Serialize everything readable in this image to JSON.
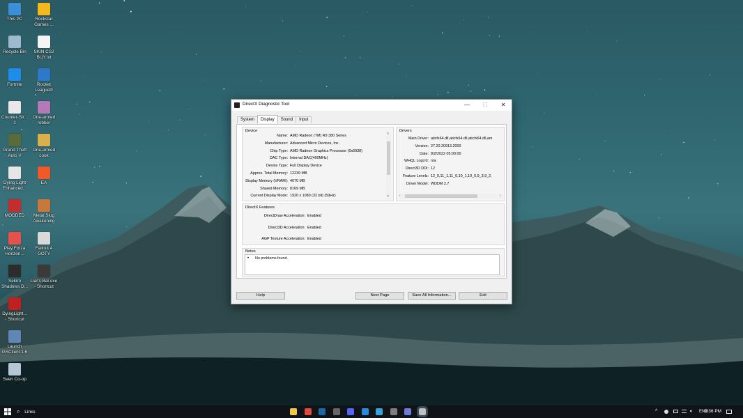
{
  "desktop_icons": [
    {
      "label": "This PC",
      "color": "#3b8fd6"
    },
    {
      "label": "Recycle Bin",
      "color": "#9fb9cf"
    },
    {
      "label": "Fortnite",
      "color": "#1f8cea"
    },
    {
      "label": "Counter-Str...\n2",
      "color": "#e8e8e8"
    },
    {
      "label": "Grand Theft\nAuto V",
      "color": "#5a6b3a"
    },
    {
      "label": "Dying Light\nEnhanced...",
      "color": "#e6e6e6"
    },
    {
      "label": "MODDED",
      "color": "#c42d2d"
    },
    {
      "label": "Play Forza\nHorizon...",
      "color": "#e6524a"
    },
    {
      "label": "Sekiro\nShadows D...",
      "color": "#2c2c2c"
    },
    {
      "label": "DyingLight...\n- Shortcut",
      "color": "#c02020"
    },
    {
      "label": "Launch\nGSClient 1.6",
      "color": "#5f86b5"
    },
    {
      "label": "Sven Co-op",
      "color": "#b6c6d6"
    },
    {
      "label": "Rockstar\nGames ...",
      "color": "#f2b81e"
    },
    {
      "label": "SKIN CS2\nBUY.txt",
      "color": "#f4f4f4"
    },
    {
      "label": "Rocket\nLeague®",
      "color": "#2e78c8"
    },
    {
      "label": "One-armed\nrobber",
      "color": "#b37ab7"
    },
    {
      "label": "One-armed\ncook",
      "color": "#d9b14c"
    },
    {
      "label": "EA",
      "color": "#f05a28"
    },
    {
      "label": "Metal Slug\nAwakening",
      "color": "#c8783c"
    },
    {
      "label": "Fallout 4\nGOTY",
      "color": "#d9d9d9"
    },
    {
      "label": "Liar's Bar.exe\n- Shortcut",
      "color": "#3a3a3a"
    }
  ],
  "window": {
    "title": "DirectX Diagnostic Tool",
    "controls": {
      "minimize": "—",
      "maximize": "☐",
      "close": "✕"
    },
    "tabs": [
      "System",
      "Display",
      "Sound",
      "Input"
    ],
    "active_tab": "Display",
    "device": {
      "title": "Device",
      "rows": [
        {
          "label": "Name:",
          "value": "AMD Radeon (TM) R9 380 Series"
        },
        {
          "label": "Manufacturer:",
          "value": "Advanced Micro Devices, Inc."
        },
        {
          "label": "Chip Type:",
          "value": "AMD Radeon Graphics Processor (0x6938)"
        },
        {
          "label": "DAC Type:",
          "value": "Internal DAC(400MHz)"
        },
        {
          "label": "Device Type:",
          "value": "Full Display Device"
        },
        {
          "label": "Approx. Total Memory:",
          "value": "12239 MB"
        },
        {
          "label": "Display Memory (VRAM):",
          "value": "4070 MB"
        },
        {
          "label": "Shared Memory:",
          "value": "8169 MB"
        },
        {
          "label": "Current Display Mode:",
          "value": "1920 x 1080 (32 bit) (59Hz)"
        }
      ]
    },
    "drivers": {
      "title": "Drivers",
      "rows": [
        {
          "label": "Main Driver:",
          "value": "aticfx64.dll,aticfx64.dll,aticfx64.dll,am"
        },
        {
          "label": "Version:",
          "value": "27.20.20913.2000"
        },
        {
          "label": "Date:",
          "value": "8/2/2022 05:00:00"
        },
        {
          "label": "WHQL Logo'd:",
          "value": "n/a"
        },
        {
          "label": "Direct3D DDI:",
          "value": "12"
        },
        {
          "label": "Feature Levels:",
          "value": "12_0,11_1,11_0,10_1,10_0,9_3,9_2,"
        },
        {
          "label": "Driver Model:",
          "value": "WDDM 2.7"
        }
      ]
    },
    "features": {
      "title": "DirectX Features",
      "rows": [
        {
          "label": "DirectDraw Acceleration:",
          "value": "Enabled"
        },
        {
          "label": "Direct3D Acceleration:",
          "value": "Enabled"
        },
        {
          "label": "AGP Texture Acceleration:",
          "value": "Enabled"
        }
      ]
    },
    "notes": {
      "title": "Notes",
      "items": [
        "No problems found."
      ]
    },
    "buttons": {
      "help": "Help",
      "next_page": "Next Page",
      "save_all": "Save All Information...",
      "exit": "Exit"
    }
  },
  "taskbar": {
    "search_label": "Links",
    "apps": [
      {
        "name": "file-explorer-icon",
        "color": "#f2c84b"
      },
      {
        "name": "chrome-icon",
        "color": "#e04a3a"
      },
      {
        "name": "steam-icon",
        "color": "#1b6aa5"
      },
      {
        "name": "app-icon",
        "color": "#666666"
      },
      {
        "name": "discord-icon",
        "color": "#5865f2"
      },
      {
        "name": "browser-icon",
        "color": "#2a8cd8"
      },
      {
        "name": "ubisoft-icon",
        "color": "#33a3dc"
      },
      {
        "name": "gpu-icon",
        "color": "#7d7d7d"
      },
      {
        "name": "app-circle-icon",
        "color": "#6b7bd8"
      },
      {
        "name": "dxdiag-icon",
        "color": "#c0c0c0"
      }
    ],
    "tray": {
      "chevron": "^",
      "lang": "ENG",
      "time": "9:36 PM"
    }
  }
}
